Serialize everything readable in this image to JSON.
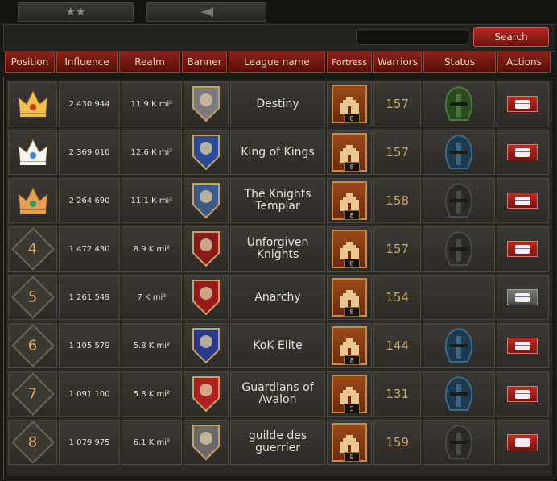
{
  "tabs": [
    {
      "label": "★★"
    },
    {
      "label": ""
    }
  ],
  "search": {
    "placeholder": "",
    "button": "Search"
  },
  "columns": [
    "Position",
    "Influence",
    "Realm",
    "Banner",
    "League name",
    "Fortress",
    "Warriors",
    "Status",
    "Actions"
  ],
  "rows": [
    {
      "position": "1",
      "influence": "2 430 944",
      "realm": "11.9 K mi²",
      "name": "Destiny",
      "fortress": "8",
      "warriors": "157",
      "status": "green",
      "action": "enabled"
    },
    {
      "position": "2",
      "influence": "2 369 010",
      "realm": "12.6 K mi²",
      "name": "King of Kings",
      "fortress": "8",
      "warriors": "157",
      "status": "blue",
      "action": "enabled"
    },
    {
      "position": "3",
      "influence": "2 264 690",
      "realm": "11.1 K mi²",
      "name": "The Knights Templar",
      "fortress": "8",
      "warriors": "158",
      "status": "dark",
      "action": "enabled"
    },
    {
      "position": "4",
      "influence": "1 472 430",
      "realm": "8.9 K mi²",
      "name": "Unforgiven Knights",
      "fortress": "8",
      "warriors": "157",
      "status": "dark",
      "action": "enabled"
    },
    {
      "position": "5",
      "influence": "1 261 549",
      "realm": "7 K mi²",
      "name": "Anarchy",
      "fortress": "8",
      "warriors": "154",
      "status": "none",
      "action": "disabled"
    },
    {
      "position": "6",
      "influence": "1 105 579",
      "realm": "5.8 K mi²",
      "name": "KoK Elite",
      "fortress": "8",
      "warriors": "144",
      "status": "blue",
      "action": "enabled"
    },
    {
      "position": "7",
      "influence": "1 091 100",
      "realm": "5.8 K mi²",
      "name": "Guardians of Avalon",
      "fortress": "5",
      "warriors": "131",
      "status": "blue",
      "action": "enabled"
    },
    {
      "position": "8",
      "influence": "1 079 975",
      "realm": "6.1 K mi²",
      "name": "guilde des guerrier",
      "fortress": "9",
      "warriors": "159",
      "status": "dark",
      "action": "enabled"
    }
  ],
  "icons": {
    "crown_gold": "crown-gold-icon",
    "crown_silver": "crown-silver-icon",
    "crown_bronze": "crown-bronze-icon",
    "fortress": "fortress-icon",
    "helmet": "helmet-icon",
    "mail": "mail-icon"
  },
  "colors": {
    "accent_red": "#8a2018",
    "warriors_gold": "#c9a86a",
    "rank_text": "#d6a46a"
  }
}
